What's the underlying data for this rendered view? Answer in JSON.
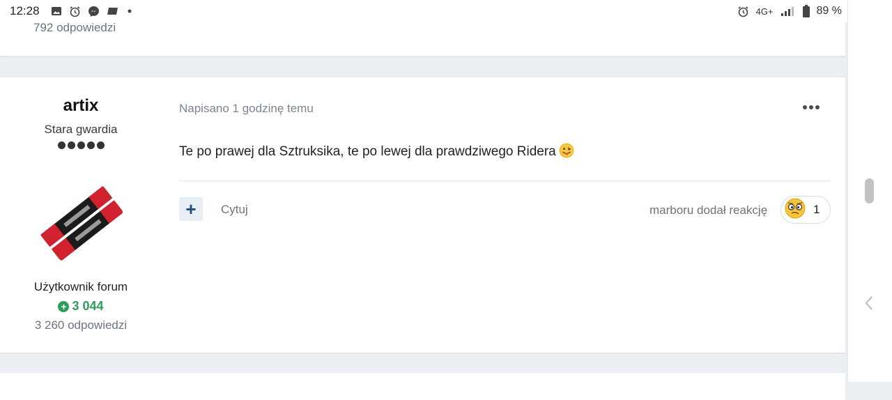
{
  "status_bar": {
    "time": "12:28",
    "network": "4G+",
    "battery": "89 %",
    "icons": [
      "image-icon",
      "alarm-icon",
      "messenger-icon",
      "app-icon",
      "dot-icon",
      "alarm-icon",
      "signal-icon",
      "battery-icon"
    ]
  },
  "previous_post": {
    "replies": "792 odpowiedzi"
  },
  "post": {
    "author": {
      "name": "artix",
      "group": "Stara gwardia",
      "pips": 5,
      "rank_title": "Użytkownik forum",
      "reputation": "3 044",
      "replies": "3 260 odpowiedzi"
    },
    "posted": "Napisano 1 godzinę temu",
    "text": "Te po prawej dla Sztruksika, te po lewej dla prawdziwego Ridera",
    "quote_label": "Cytuj",
    "plus_label": "+",
    "reaction": {
      "label": "marboru dodał reakcję",
      "count": "1"
    }
  },
  "colors": {
    "reputation_green": "#2f9c5c",
    "accent_blue": "#1f4e7d",
    "page_bg": "#ebeef2"
  }
}
